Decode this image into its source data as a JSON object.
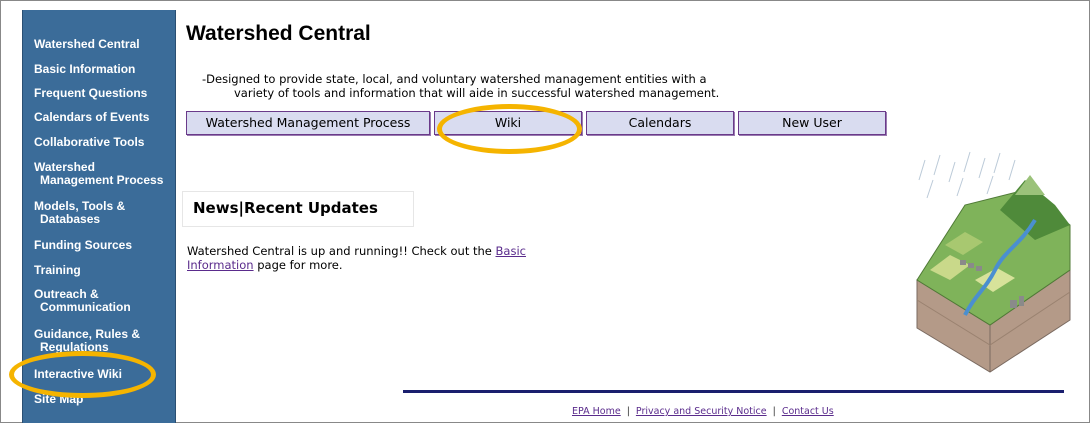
{
  "sidebar": {
    "items": [
      {
        "line1": "Watershed Central",
        "line2": ""
      },
      {
        "line1": "Basic Information",
        "line2": ""
      },
      {
        "line1": "Frequent Questions",
        "line2": ""
      },
      {
        "line1": "Calendars of Events",
        "line2": ""
      },
      {
        "line1": "Collaborative Tools",
        "line2": ""
      },
      {
        "line1": "Watershed",
        "line2": "Management Process"
      },
      {
        "line1": "Models, Tools &",
        "line2": "Databases"
      },
      {
        "line1": "Funding Sources",
        "line2": ""
      },
      {
        "line1": "Training",
        "line2": ""
      },
      {
        "line1": "Outreach &",
        "line2": "Communication"
      },
      {
        "line1": "Guidance, Rules &",
        "line2": "Regulations"
      },
      {
        "line1": "Interactive Wiki",
        "line2": ""
      },
      {
        "line1": "Site Map",
        "line2": ""
      }
    ]
  },
  "main": {
    "title": "Watershed Central",
    "description_line1": "-Designed to provide state, local, and voluntary watershed management entities with a",
    "description_line2": "variety of tools and information that will aide in successful watershed management.",
    "nav_buttons": [
      {
        "label": "Watershed Management Process"
      },
      {
        "label": "Wiki"
      },
      {
        "label": "Calendars"
      },
      {
        "label": "New User"
      }
    ],
    "news": {
      "heading": "News|Recent Updates",
      "text_before": "Watershed Central is up and running!! Check out the ",
      "link_text": "Basic Information",
      "text_after": " page for more."
    }
  },
  "footer": {
    "links": [
      {
        "label": "EPA Home"
      },
      {
        "label": "Privacy and Security Notice"
      },
      {
        "label": "Contact Us"
      }
    ]
  },
  "colors": {
    "sidebar_bg": "#3b6c99",
    "button_bg": "#d9dcf0",
    "highlight": "#f5b400",
    "footer_rule": "#1a1f6e",
    "link": "#5a2b8c"
  },
  "icons": {
    "illustration": "watershed-landscape-illustration"
  }
}
